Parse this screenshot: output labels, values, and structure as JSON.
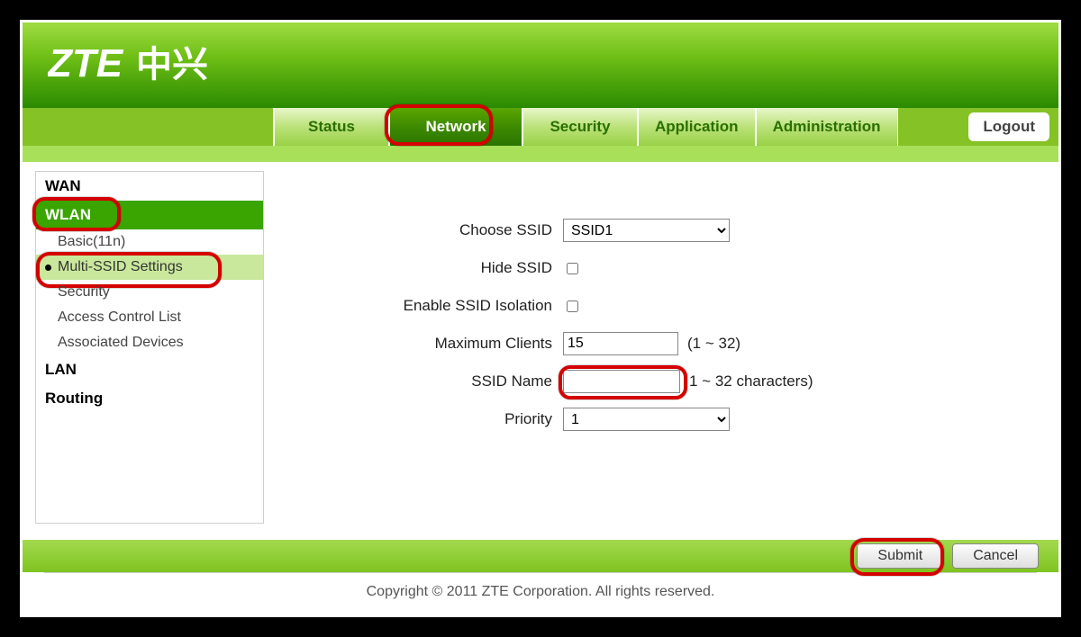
{
  "brand": "ZTE中兴",
  "nav": {
    "tabs": [
      {
        "label": "Status",
        "active": false
      },
      {
        "label": "Network",
        "active": true
      },
      {
        "label": "Security",
        "active": false
      },
      {
        "label": "Application",
        "active": false
      },
      {
        "label": "Administration",
        "active": false
      }
    ],
    "logout": "Logout"
  },
  "sidebar": {
    "groups": [
      {
        "label": "WAN",
        "selected": false,
        "items": []
      },
      {
        "label": "WLAN",
        "selected": true,
        "items": [
          {
            "label": "Basic(11n)",
            "active": false
          },
          {
            "label": "Multi-SSID Settings",
            "active": true
          },
          {
            "label": "Security",
            "active": false
          },
          {
            "label": "Access Control List",
            "active": false
          },
          {
            "label": "Associated Devices",
            "active": false
          }
        ]
      },
      {
        "label": "LAN",
        "selected": false,
        "items": []
      },
      {
        "label": "Routing",
        "selected": false,
        "items": []
      }
    ]
  },
  "form": {
    "choose_ssid": {
      "label": "Choose SSID",
      "value": "SSID1"
    },
    "hide_ssid": {
      "label": "Hide SSID",
      "checked": false
    },
    "isolation": {
      "label": "Enable SSID Isolation",
      "checked": false
    },
    "max_clients": {
      "label": "Maximum Clients",
      "value": "15",
      "hint": "(1 ~ 32)"
    },
    "ssid_name": {
      "label": "SSID Name",
      "value": "",
      "hint": "1 ~ 32 characters)"
    },
    "priority": {
      "label": "Priority",
      "value": "1"
    }
  },
  "buttons": {
    "submit": "Submit",
    "cancel": "Cancel"
  },
  "footer": "Copyright © 2011 ZTE Corporation. All rights reserved."
}
